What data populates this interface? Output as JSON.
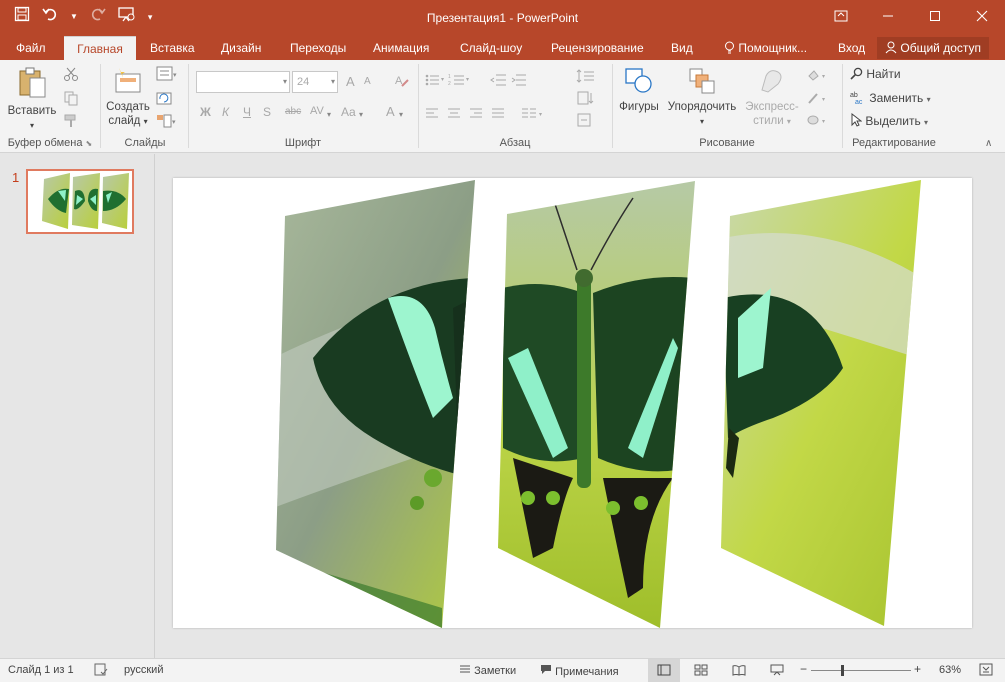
{
  "app": {
    "title": "Презентация1 - PowerPoint",
    "accent": "#b7472a"
  },
  "qat": {
    "save_icon": "save-icon",
    "undo_icon": "undo-icon",
    "redo_icon": "redo-icon",
    "present_icon": "start-from-beginning-icon",
    "customize_icon": "customize-qat-icon"
  },
  "tabs": [
    {
      "label": "Файл"
    },
    {
      "label": "Главная"
    },
    {
      "label": "Вставка"
    },
    {
      "label": "Дизайн"
    },
    {
      "label": "Переходы"
    },
    {
      "label": "Анимация"
    },
    {
      "label": "Слайд-шоу"
    },
    {
      "label": "Рецензирование"
    },
    {
      "label": "Вид"
    },
    {
      "label": "Помощник..."
    },
    {
      "label": "Вход"
    }
  ],
  "share_label": "Общий доступ",
  "ribbon": {
    "clipboard": {
      "paste": "Вставить",
      "group": "Буфер обмена"
    },
    "slides": {
      "new_slide_1": "Создать",
      "new_slide_2": "слайд",
      "group": "Слайды"
    },
    "font": {
      "font_name": "",
      "font_size": "24",
      "bold": "Ж",
      "italic": "К",
      "underline": "Ч",
      "strike": "S",
      "strike_extra": "abc",
      "spacing": "AV",
      "case": "Aa",
      "color": "A",
      "grow": "A",
      "shrink": "A",
      "group": "Шрифт"
    },
    "paragraph": {
      "group": "Абзац"
    },
    "drawing": {
      "shapes": "Фигуры",
      "arrange": "Упорядочить",
      "styles_1": "Экспресс-",
      "styles_2": "стили",
      "group": "Рисование"
    },
    "editing": {
      "find": "Найти",
      "replace": "Заменить",
      "select": "Выделить",
      "group": "Редактирование"
    }
  },
  "thumbnails": [
    {
      "number": "1"
    }
  ],
  "status": {
    "slide_of": "Слайд 1 из 1",
    "language": "русский",
    "notes": "Заметки",
    "comments": "Примечания",
    "zoom": "63%",
    "zoom_level": 0.63
  }
}
